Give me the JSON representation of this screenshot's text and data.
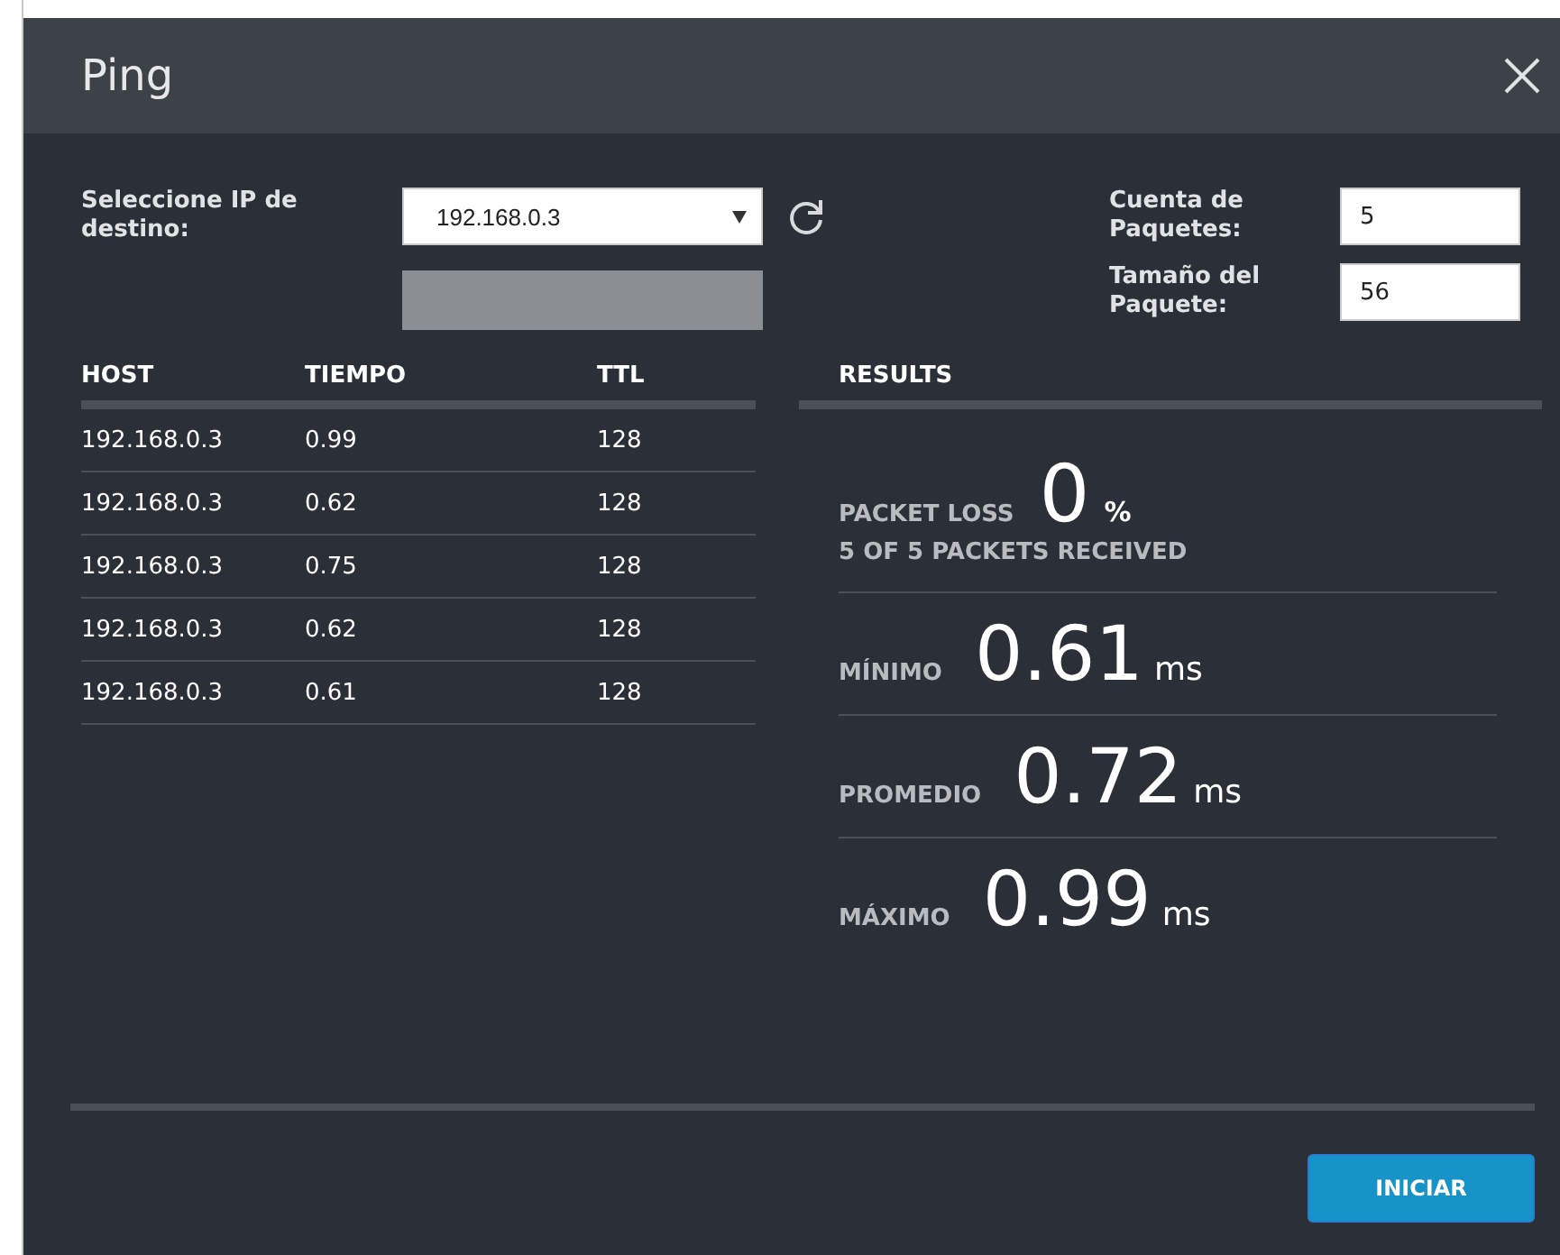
{
  "dialog": {
    "title": "Ping"
  },
  "destination": {
    "label": "Seleccione IP de destino:",
    "value": "192.168.0.3"
  },
  "packet_count": {
    "label": "Cuenta de Paquetes:",
    "value": "5"
  },
  "packet_size": {
    "label": "Tamaño del Paquete:",
    "value": "56"
  },
  "table": {
    "columns": [
      "HOST",
      "TIEMPO",
      "TTL"
    ],
    "rows": [
      {
        "host": "192.168.0.3",
        "time": "0.99",
        "ttl": "128"
      },
      {
        "host": "192.168.0.3",
        "time": "0.62",
        "ttl": "128"
      },
      {
        "host": "192.168.0.3",
        "time": "0.75",
        "ttl": "128"
      },
      {
        "host": "192.168.0.3",
        "time": "0.62",
        "ttl": "128"
      },
      {
        "host": "192.168.0.3",
        "time": "0.61",
        "ttl": "128"
      }
    ]
  },
  "results": {
    "heading": "RESULTS",
    "packet_loss": {
      "label": "PACKET LOSS",
      "value": "0",
      "unit": "%"
    },
    "received": "5 OF 5 PACKETS RECEIVED",
    "stats": [
      {
        "label": "MÍNIMO",
        "value": "0.61",
        "unit": "ms"
      },
      {
        "label": "PROMEDIO",
        "value": "0.72",
        "unit": "ms"
      },
      {
        "label": "MÁXIMO",
        "value": "0.99",
        "unit": "ms"
      }
    ]
  },
  "buttons": [
    "INICIAR"
  ]
}
